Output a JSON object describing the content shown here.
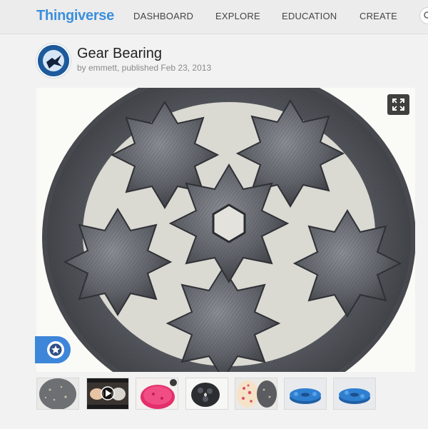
{
  "header": {
    "logo": "Thingiverse",
    "nav": [
      {
        "label": "DASHBOARD",
        "name": "nav-dashboard"
      },
      {
        "label": "EXPLORE",
        "name": "nav-explore"
      },
      {
        "label": "EDUCATION",
        "name": "nav-education"
      },
      {
        "label": "CREATE",
        "name": "nav-create"
      }
    ],
    "search_icon": "search-icon"
  },
  "thing": {
    "title": "Gear Bearing",
    "byline": "by emmett, published Feb 23, 2013",
    "avatar_icon": "avatar-image"
  },
  "viewer": {
    "expand_icon": "expand-icon",
    "favorite_icon": "star-icon"
  },
  "thumbnails": [
    {
      "name": "thumbnail-1",
      "desc": "gray-print"
    },
    {
      "name": "thumbnail-2",
      "desc": "video",
      "icon": "play-icon"
    },
    {
      "name": "thumbnail-3",
      "desc": "pink-print"
    },
    {
      "name": "thumbnail-4",
      "desc": "black-gear-bearing"
    },
    {
      "name": "thumbnail-5",
      "desc": "speckled-prints"
    },
    {
      "name": "thumbnail-6",
      "desc": "blue-render"
    },
    {
      "name": "thumbnail-7",
      "desc": "blue-render"
    }
  ],
  "colors": {
    "brand": "#3b8fdc",
    "favorite_tab": "#3d86d9"
  }
}
